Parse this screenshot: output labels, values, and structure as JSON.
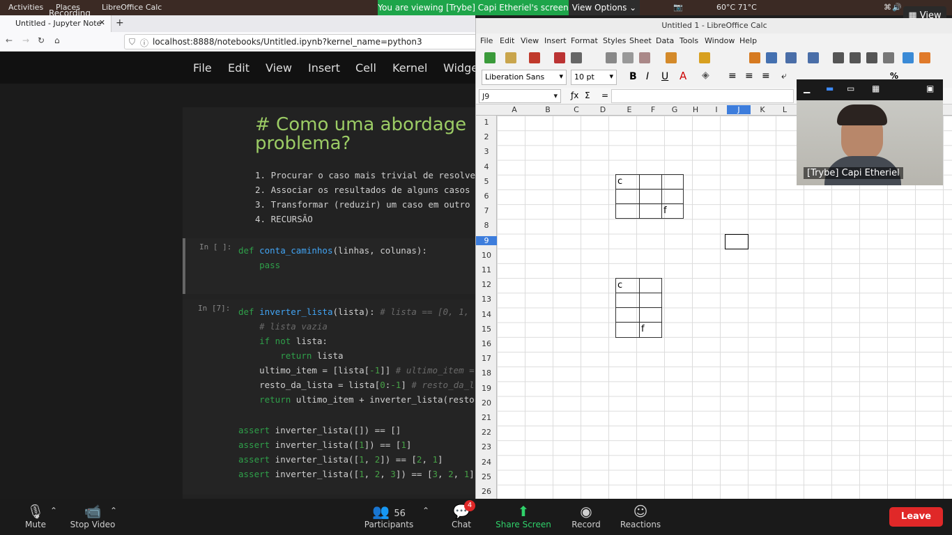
{
  "topbar": {
    "activities": "Activities",
    "places": "Places",
    "app": "LibreOffice Calc",
    "recording": "Recording",
    "temps": "60°C  71°C"
  },
  "zoom": {
    "share_banner": "You are viewing [Trybe] Capi Etheriel's screen",
    "view_options": "View Options",
    "view_button": "View",
    "participant_name": "[Trybe] Capi Etheriel",
    "mute": "Mute",
    "stop_video": "Stop Video",
    "participants": "Participants",
    "participants_count": "56",
    "chat": "Chat",
    "chat_badge": "4",
    "share_screen": "Share Screen",
    "record": "Record",
    "reactions": "Reactions",
    "leave": "Leave"
  },
  "browser": {
    "tab_title": "Untitled - Jupyter Note",
    "url": "localhost:8888/notebooks/Untitled.ipynb?kernel_name=python3"
  },
  "jupyter": {
    "menu": [
      "File",
      "Edit",
      "View",
      "Insert",
      "Cell",
      "Kernel",
      "Widge"
    ],
    "heading": "# Como uma abordage",
    "heading2": "problema?",
    "list": [
      "1. Procurar o caso mais trivial de resolve",
      "2. Associar os resultados de alguns casos",
      "3. Transformar (reduzir) um caso em outro",
      "4. RECURSÃO"
    ],
    "prompt1": "In [ ]:",
    "prompt2": "In [7]:"
  },
  "calc": {
    "title": "Untitled 1 - LibreOffice Calc",
    "menu": [
      "File",
      "Edit",
      "View",
      "Insert",
      "Format",
      "Styles",
      "Sheet",
      "Data",
      "Tools",
      "Window",
      "Help"
    ],
    "font_name": "Liberation Sans",
    "font_size": "10 pt",
    "cell_ref": "J9",
    "columns": [
      "A",
      "B",
      "C",
      "D",
      "E",
      "F",
      "G",
      "H",
      "I",
      "J",
      "K",
      "L"
    ],
    "rows": [
      "1",
      "2",
      "3",
      "4",
      "5",
      "6",
      "7",
      "8",
      "9",
      "10",
      "11",
      "12",
      "13",
      "14",
      "15",
      "16",
      "17",
      "18",
      "19",
      "20",
      "21",
      "22",
      "23",
      "24",
      "25",
      "26"
    ],
    "grid1_start": "c",
    "grid1_end": "f",
    "grid2_start": "c",
    "grid2_end": "f"
  }
}
